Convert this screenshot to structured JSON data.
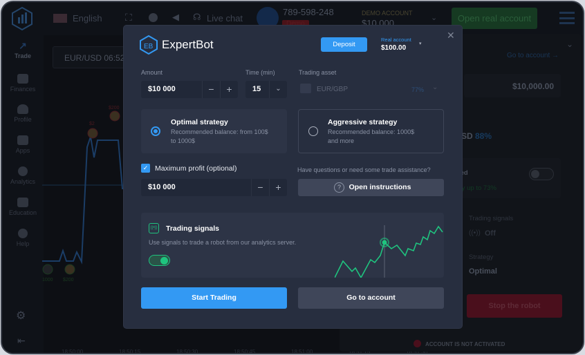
{
  "topbar": {
    "language": "English",
    "live_chat": "Live chat",
    "user_id": "789-598-248",
    "user_badge": "Demo",
    "account_type": "DEMO ACCOUNT",
    "account_balance": "$10,000",
    "open_real_account": "Open real account"
  },
  "sidebar": {
    "items": [
      {
        "label": "Trade",
        "icon": "trend-icon"
      },
      {
        "label": "Finances",
        "icon": "money-icon"
      },
      {
        "label": "Profile",
        "icon": "user-icon"
      },
      {
        "label": "Apps",
        "icon": "grid-icon"
      },
      {
        "label": "Analytics",
        "icon": "pie-icon"
      },
      {
        "label": "Education",
        "icon": "graduation-icon"
      },
      {
        "label": "Help",
        "icon": "info-icon"
      }
    ]
  },
  "chart": {
    "asset": "EUR/USD 06:52",
    "trade_labels": [
      "$200",
      "$2",
      "1000",
      "$200"
    ],
    "time_ticks": [
      "18:50:00",
      "18:50:15",
      "18:50:30",
      "18:50:45",
      "18:51:00",
      "18:51:15",
      "18:51:30"
    ]
  },
  "right_panel": {
    "go_to_account": "Go to account →",
    "balance": "$10,000.00",
    "asset_fragment": "SD",
    "asset_percent": "88%",
    "toggle_label_fragment": "led",
    "accuracy_fragment": "cy up to 73%",
    "signals_label": "Trading signals",
    "signals_value": "Off",
    "strategy_label": "Strategy",
    "strategy_value": "Optimal",
    "stop_button": "Stop the robot",
    "account_warning": "ACCOUNT IS NOT ACTIVATED"
  },
  "modal": {
    "brand": "ExpertBot",
    "logo_letters": "EB",
    "deposit": "Deposit",
    "account_label": "Real account",
    "account_balance": "$100.00",
    "amount_label": "Amount",
    "amount_value": "$10 000",
    "time_label": "Time (min)",
    "time_value": "15",
    "asset_label": "Trading asset",
    "asset_value": "EUR/GBP",
    "asset_percent": "77%",
    "strategies": [
      {
        "title": "Optimal strategy",
        "desc": "Recommended balance: from 100$ to 1000$",
        "selected": true
      },
      {
        "title": "Aggressive strategy",
        "desc": "Recommended balance: 1000$ and more",
        "selected": false
      }
    ],
    "max_profit_label": "Maximum profit (optional)",
    "max_profit_checked": true,
    "max_profit_value": "$10 000",
    "help_text": "Have questions or need some trade assistance?",
    "open_instructions": "Open instructions",
    "signals_title": "Trading signals",
    "signals_desc": "Use signals to trade a robot from our analytics server.",
    "signals_enabled": true,
    "start_trading": "Start Trading",
    "go_to_account": "Go to account"
  },
  "colors": {
    "accent": "#3399f3",
    "green": "#1fc47f",
    "modal_bg": "#272e3f",
    "stop_red": "#4a0f1c"
  }
}
